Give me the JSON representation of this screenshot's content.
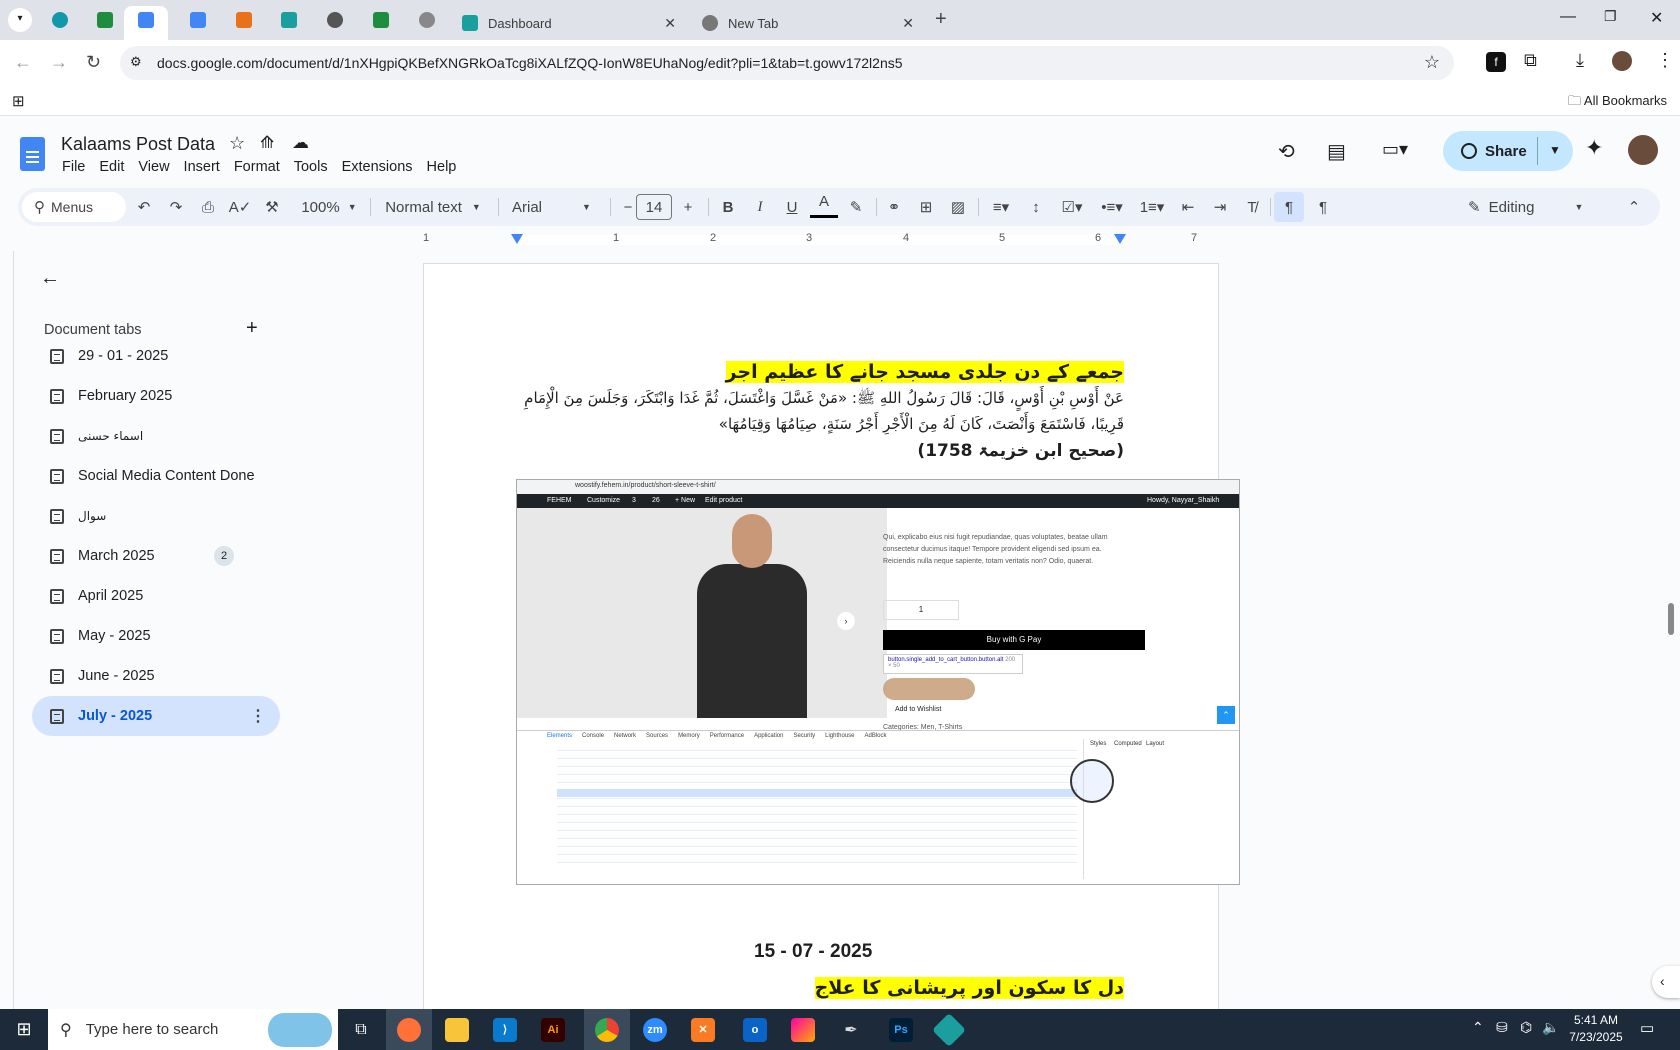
{
  "browser": {
    "tabs": [
      {
        "label": "Dashboard"
      },
      {
        "label": "New Tab"
      }
    ],
    "url": "docs.google.com/document/d/1nXHgpiQKBefXNGRkOaTcg8iXALfZQQ-IonW8EUhaNog/edit?pli=1&tab=t.gowv172l2ns5",
    "bookmarks_label": "All Bookmarks"
  },
  "doc": {
    "title": "Kalaams Post Data",
    "menus": [
      "File",
      "Edit",
      "View",
      "Insert",
      "Format",
      "Tools",
      "Extensions",
      "Help"
    ],
    "share_label": "Share"
  },
  "toolbar": {
    "menus_label": "Menus",
    "zoom": "100%",
    "style": "Normal text",
    "font": "Arial",
    "font_size": "14",
    "mode": "Editing"
  },
  "ruler": {
    "ticks": [
      "1",
      "1",
      "2",
      "3",
      "4",
      "5",
      "6",
      "7"
    ]
  },
  "sidebar": {
    "heading": "Document tabs",
    "items": [
      {
        "label": "29 - 01 - 2025"
      },
      {
        "label": "February 2025"
      },
      {
        "label": "اسماء حسنی"
      },
      {
        "label": "Social Media Content Done"
      },
      {
        "label": "سوال"
      },
      {
        "label": "March 2025",
        "badge": "2"
      },
      {
        "label": "April 2025"
      },
      {
        "label": "May - 2025"
      },
      {
        "label": "June - 2025"
      },
      {
        "label": "July - 2025"
      }
    ]
  },
  "content": {
    "heading1": "جمعے کے دن جلدی مسجد جانے کا عظیم اجر",
    "arabic_line1": "عَنْ أَوْسِ بْنِ أَوْسٍ، قَالَ: قَالَ رَسُولُ اللهِ ﷺ: «مَنْ غَسَّلَ وَاغْتَسَلَ، ثُمَّ غَدَا وَابْتَكَرَ، وَجَلَسَ مِنَ الْإِمَامِ",
    "arabic_line2": "قَرِيبًا، فَاسْتَمَعَ وَأَنْصَتَ، كَانَ لَهُ مِنَ الْأَجْرِ أَجْرُ سَنَةٍ، صِيَامُهَا وَقِيَامُهَا»",
    "reference": "(صحیح ابن خزیمۃ 1758)",
    "date": "15 - 07 - 2025",
    "heading2": "دل کا سکون اور پریشانی کا علاج"
  },
  "screenshot": {
    "url": "woostify.fehem.in/product/short-sleeve-t-shirt/",
    "admin_items": [
      "FEHEM",
      "Customize",
      "3",
      "26",
      "+ New",
      "Edit product"
    ],
    "howdy": "Howdy, Nayyar_Shaikh",
    "description": "Qui, explicabo eius nisi fugit repudiandae, quas voluptates, beatae ullam consectetur ducimus itaque! Tempore provident eligendi sed ipsum ea. Reiciendis nulla neque sapiente, totam veritatis non? Odio, quaerat.",
    "qty": "1",
    "buy_label": "Buy with G Pay",
    "tooltip": "button.single_add_to_cart_button.button.alt",
    "tooltip_size": "200 × 50",
    "wishlist": "Add to Wishlist",
    "categories": "Categories: Men, T-Shirts",
    "devtools_tabs": [
      "Elements",
      "Console",
      "Network",
      "Sources",
      "Memory",
      "Performance",
      "Application",
      "Security",
      "Lighthouse",
      "AdBlock"
    ],
    "styles_tabs": [
      "Styles",
      "Computed",
      "Layout"
    ]
  },
  "taskbar": {
    "search_placeholder": "Type here to search",
    "time": "5:41 AM",
    "date": "7/23/2025"
  }
}
